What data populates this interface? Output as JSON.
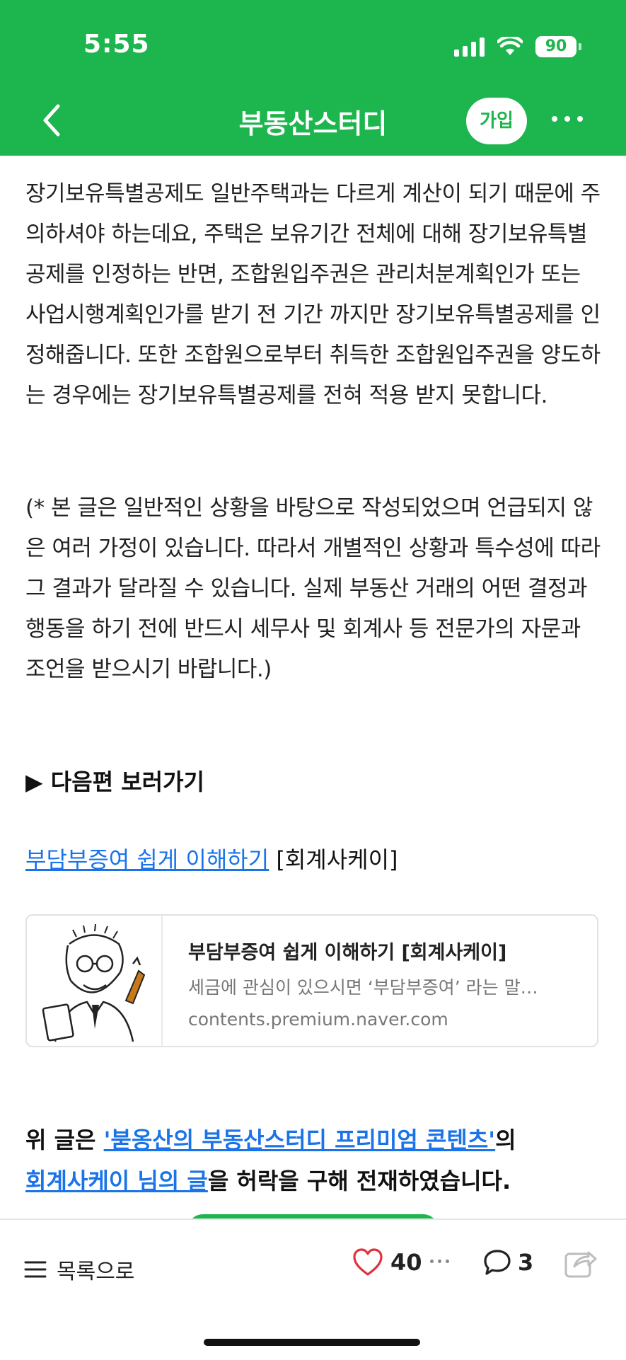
{
  "status": {
    "time": "5:55",
    "battery": "90"
  },
  "header": {
    "title": "부동산스터디",
    "join_label": "가입"
  },
  "paragraphs": [
    "장기보유특별공제도 일반주택과는 다르게 계산이 되기 때문에 주의하셔야 하는데요, 주택은 보유기간 전체에 대해 장기보유특별공제를 인정하는 반면, 조합원입주권은 관리처분계획인가 또는 사업시행계획인가를 받기 전 기간 까지만 장기보유특별공제를 인정해줍니다. 또한 조합원으로부터 취득한 조합원입주권을 양도하는 경우에는 장기보유특별공제를 전혀 적용 받지 못합니다.",
    "(* 본 글은 일반적인 상황을 바탕으로 작성되었으며 언급되지 않은 여러 가정이 있습니다. 따라서 개별적인 상황과 특수성에 따라 그 결과가 달라질 수 있습니다. 실제 부동산 거래의 어떤 결정과 행동을 하기 전에 반드시 세무사 및 회계사 등 전문가의 자문과 조언을 받으시기 바랍니다.)"
  ],
  "next": {
    "heading": "▶ 다음편 보러가기",
    "link_text": "부담부증여 쉽게 이해하기",
    "link_suffix": " [회계사케이]"
  },
  "card": {
    "title": "부담부증여 쉽게 이해하기 [회계사케이]",
    "description": "세금에 관심이 있으시면 ‘부담부증여’ 라는 말…",
    "url": "contents.premium.naver.com"
  },
  "credit": {
    "prefix": "위 글은 ",
    "link1": "'붇옹산의 부동산스터디 프리미엄 콘텐츠'",
    "mid": "의",
    "link2": "회계사케이 님의 글",
    "suffix": "을 허락을 구해 전재하였습니다."
  },
  "bottom": {
    "list_label": "목록으로",
    "like_count": "40",
    "comment_count": "3"
  }
}
